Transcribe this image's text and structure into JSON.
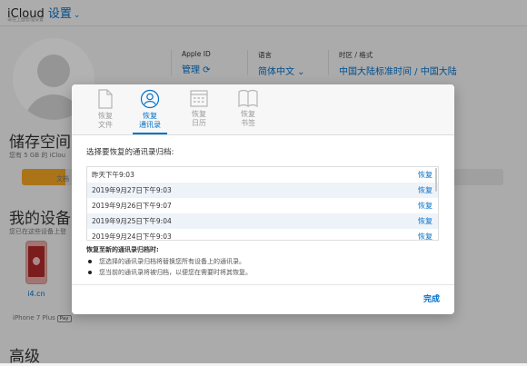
{
  "header": {
    "brand": "iCloud",
    "title": "设置",
    "subline": "请在上面管理设置"
  },
  "account": {
    "apple_id_label": "Apple ID",
    "apple_id_value": "管理 ⟳",
    "language_label": "语言",
    "language_value": "简体中文 ⌄",
    "timezone_label": "时区 / 格式",
    "timezone_value": "中国大陆标准时间 / 中国大陆"
  },
  "storage": {
    "heading": "储存空间",
    "subtitle": "您有 5 GB 的 iClou",
    "bar_label": "文档",
    "used_fraction": 0.09,
    "bar_color": "#f5a623"
  },
  "devices": {
    "heading": "我的设备",
    "subtitle": "您已在这些设备上登",
    "device_name": "i4.cn",
    "device_model": "iPhone 7 Plus",
    "pay_badge": " Pay"
  },
  "advanced": {
    "heading": "高级"
  },
  "modal": {
    "tabs": [
      {
        "label": "恢复\n文件",
        "icon": "file-icon"
      },
      {
        "label": "恢复\n通讯录",
        "icon": "contacts-icon",
        "active": true
      },
      {
        "label": "恢复\n日历",
        "icon": "calendar-icon"
      },
      {
        "label": "恢复\n书签",
        "icon": "bookmarks-icon"
      }
    ],
    "prompt": "选择要恢复的通讯录归档:",
    "archives": [
      {
        "date": "昨天下午9:03",
        "action": "恢复"
      },
      {
        "date": "2019年9月27日下午9:03",
        "action": "恢复"
      },
      {
        "date": "2019年9月26日下午9:07",
        "action": "恢复"
      },
      {
        "date": "2019年9月25日下午9:04",
        "action": "恢复"
      },
      {
        "date": "2019年9月24日下午9:03",
        "action": "恢复"
      }
    ],
    "note_heading": "恢复至新的通讯录归档时:",
    "notes": [
      "您选择的通讯录归档将替换您所有设备上的通讯录。",
      "您当前的通讯录将被归档，以便您在需要时将其恢复。"
    ],
    "done_label": "完成",
    "accent": "#0070c9"
  }
}
